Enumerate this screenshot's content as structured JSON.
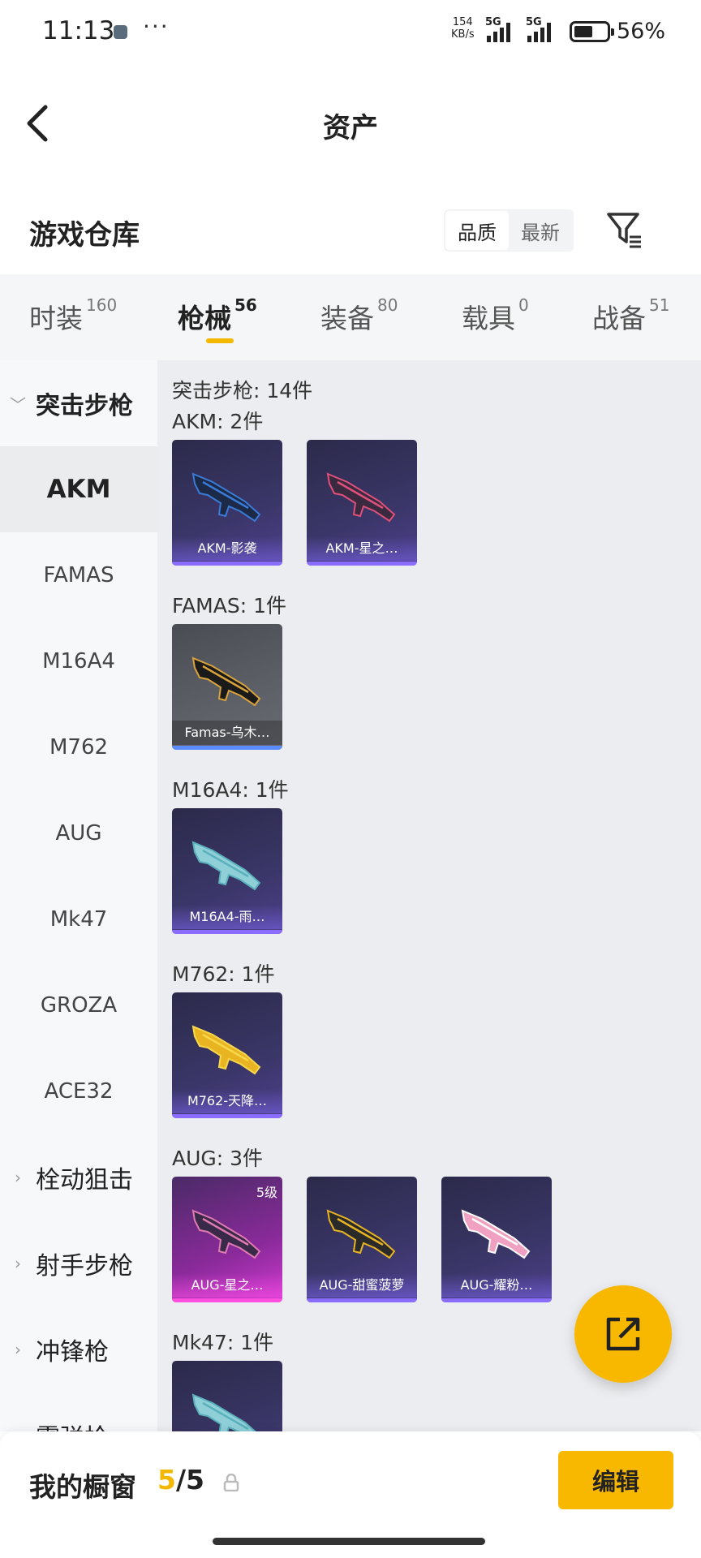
{
  "status_bar": {
    "time": "11:13",
    "net_speed_value": "154",
    "net_speed_unit": "KB/s",
    "sim1": "5G",
    "sim2": "5G",
    "battery_percent": "56%"
  },
  "header": {
    "title": "资产"
  },
  "warehouse": {
    "title": "游戏仓库",
    "sort_options": [
      "品质",
      "最新"
    ],
    "active_sort": "品质"
  },
  "tabs": [
    {
      "label": "时装",
      "count": "160"
    },
    {
      "label": "枪械",
      "count": "56",
      "active": true
    },
    {
      "label": "装备",
      "count": "80"
    },
    {
      "label": "载具",
      "count": "0"
    },
    {
      "label": "战备",
      "count": "51"
    }
  ],
  "sidebar": {
    "groups": [
      {
        "label": "突击步枪",
        "expanded": true
      },
      {
        "label": "栓动狙击"
      },
      {
        "label": "射手步枪"
      },
      {
        "label": "冲锋枪"
      },
      {
        "label": "霰弹枪"
      }
    ],
    "items": [
      "AKM",
      "FAMAS",
      "M16A4",
      "M762",
      "AUG",
      "Mk47",
      "GROZA",
      "ACE32"
    ],
    "selected_item": "AKM"
  },
  "content": {
    "summary": "突击步枪: 14件",
    "sections": [
      {
        "title": "AKM: 2件",
        "items": [
          {
            "name": "AKM-影袭",
            "gun_color": "#1c2a48",
            "accent": "#3a7bd8"
          },
          {
            "name": "AKM-星之…",
            "gun_color": "#3a2a40",
            "accent": "#e0507a"
          }
        ]
      },
      {
        "title": "FAMAS: 1件",
        "items": [
          {
            "name": "Famas-乌木…",
            "gun_color": "#1a1a1a",
            "accent": "#d9a23a"
          }
        ]
      },
      {
        "title": "M16A4: 1件",
        "items": [
          {
            "name": "M16A4-雨…",
            "gun_color": "#8fd0d8",
            "accent": "#5ab0bc"
          }
        ]
      },
      {
        "title": "M762: 1件",
        "items": [
          {
            "name": "M762-天降…",
            "gun_color": "#e8b422",
            "accent": "#f7d84a"
          }
        ]
      },
      {
        "title": "AUG: 3件",
        "items": [
          {
            "name": "AUG-星之…",
            "gun_color": "#3a2a4a",
            "accent": "#e07ab0",
            "badge": "5级"
          },
          {
            "name": "AUG-甜蜜菠萝",
            "gun_color": "#2a2a2a",
            "accent": "#e8b422"
          },
          {
            "name": "AUG-耀粉…",
            "gun_color": "#f0a0c0",
            "accent": "#ffffff"
          }
        ]
      },
      {
        "title": "Mk47: 1件",
        "items": [
          {
            "name": "",
            "gun_color": "#8fd0d8",
            "accent": "#5ab0bc"
          }
        ]
      }
    ]
  },
  "bottom_bar": {
    "title": "我的橱窗",
    "current": "5",
    "separator": "/",
    "total": "5",
    "edit_label": "编辑"
  }
}
